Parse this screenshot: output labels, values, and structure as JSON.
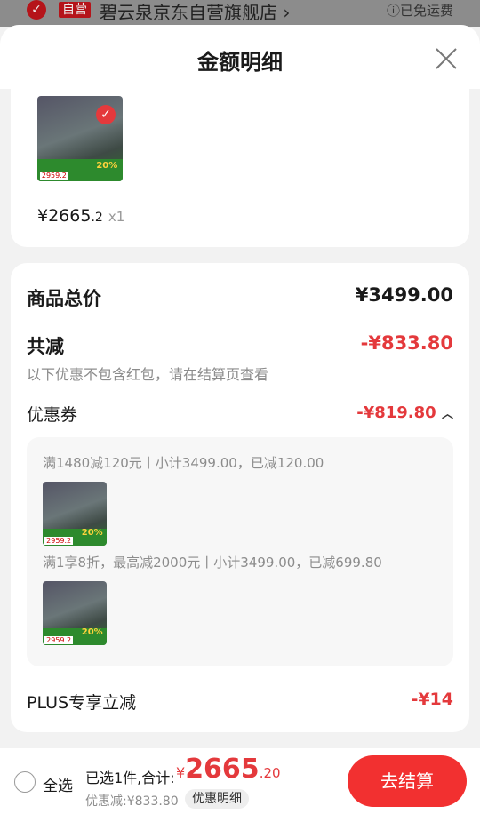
{
  "store": {
    "tag": "自营",
    "name": "碧云泉京东自营旗舰店",
    "chevron": "›",
    "shipping": "ⓘ已免运费",
    "check_icon": "check-circle-icon"
  },
  "sheet": {
    "title": "金额明细",
    "close_icon": "close-icon"
  },
  "item": {
    "price_main": "¥2665",
    "price_decimal": ".2",
    "quantity": "x1",
    "thumb_badge": "20%",
    "thumb_price": "2959.2"
  },
  "summary": {
    "goods_total_label": "商品总价",
    "goods_total_value": "¥3499.00",
    "discount_total_label": "共减",
    "discount_total_value": "-¥833.80",
    "note": "以下优惠不包含红包，请在结算页查看",
    "coupon_label": "优惠券",
    "coupon_value": "-¥819.80",
    "coupon_rules": [
      "满1480减120元丨小计3499.00，已减120.00",
      "满1享8折，最高减2000元丨小计3499.00，已减699.80"
    ],
    "plus_label": "PLUS专享立减",
    "plus_value": "-¥14"
  },
  "bottom_bar": {
    "select_all": "全选",
    "selected_text": "已选1件,合计:",
    "total_currency": "¥",
    "total_main": "2665",
    "total_decimal": ".20",
    "discount_text": "优惠减:¥833.80",
    "detail_button": "优惠明细",
    "checkout_button": "去结算"
  },
  "colors": {
    "accent": "#e4393c",
    "checkout": "#f23030"
  }
}
